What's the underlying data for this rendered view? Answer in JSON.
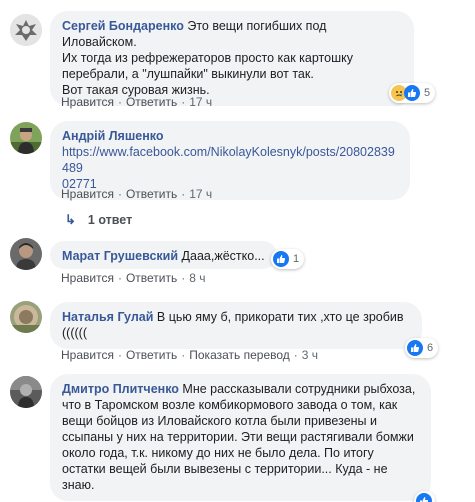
{
  "comments": [
    {
      "author": "Сергей Бондаренко",
      "text_lines": [
        "Это вещи погибших под Иловайском.",
        "Их тогда из рефрежераторов просто как картошку",
        "перебрали, а \"лушпайки\" выкинули вот так.",
        "Вот такая суровая жизнь."
      ],
      "actions": [
        "Нравится",
        "Ответить"
      ],
      "time": "17 ч",
      "reaction_count": "5",
      "reaction_icons": [
        "sad-icon",
        "like-icon"
      ]
    },
    {
      "author": "Андрій Ляшенко",
      "link_lines": [
        "https://www.facebook.com/NikolayKolesnyk/posts/20802839489",
        "02771"
      ],
      "actions": [
        "Нравится",
        "Ответить"
      ],
      "time": "17 ч",
      "replies_label": "1 ответ"
    },
    {
      "author": "Марат Грушевский",
      "text": "Дааа,жёстко...",
      "actions": [
        "Нравится",
        "Ответить"
      ],
      "time": "8 ч",
      "reaction_count": "1",
      "reaction_icons": [
        "like-icon"
      ]
    },
    {
      "author": "Наталья Гулай",
      "text_lines": [
        "В цью яму б, прикорати тих ,хто це зробив",
        "(((((("
      ],
      "actions": [
        "Нравится",
        "Ответить",
        "Показать перевод"
      ],
      "time": "3 ч",
      "reaction_count": "6",
      "reaction_icons": [
        "like-icon"
      ]
    },
    {
      "author": "Дмитро Плитченко",
      "text_lines": [
        "Мне рассказывали сотрудники рыбхоза,",
        "что в Таромском возле комбикормового завода о том, как",
        "вещи бойцов из Иловайского котла были привезены и",
        "ссыпаны у них на территории. Эти вещи растягивали бомжи",
        "около года, т.к. никому до них не было дела. По итогу",
        "остатки вещей были вывезены с территории... Куда - не",
        "знаю."
      ],
      "reaction_icons": [
        "like-icon"
      ]
    }
  ],
  "colors": {
    "author": "#385898",
    "bubble": "#f2f3f5",
    "meta": "#606770",
    "like": "#1877f2"
  }
}
